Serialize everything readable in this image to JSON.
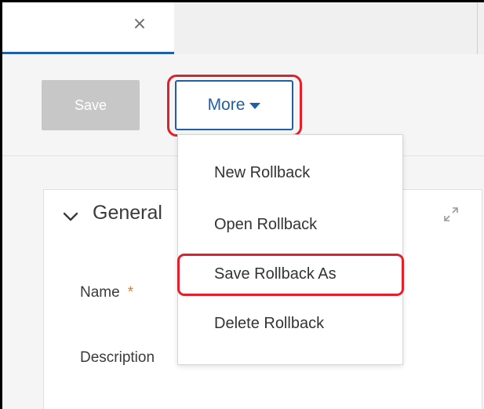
{
  "tab": {
    "close_glyph": "×"
  },
  "toolbar": {
    "save_label": "Save",
    "more_label": "More"
  },
  "menu": {
    "items": [
      {
        "label": "New Rollback"
      },
      {
        "label": "Open Rollback"
      },
      {
        "label": "Save Rollback As"
      },
      {
        "label": "Delete Rollback"
      }
    ],
    "highlighted_index": 2
  },
  "panel": {
    "title": "General",
    "fields": [
      {
        "label": "Name",
        "required_mark": "*"
      },
      {
        "label": "Description",
        "required_mark": ""
      }
    ]
  },
  "icons": {
    "tab_close": "close-icon",
    "more_caret": "caret-down-icon",
    "panel_toggle": "chevron-down-icon",
    "panel_expand": "expand-icon"
  },
  "colors": {
    "accent": "#1f5ea8",
    "highlight": "#e0202a",
    "disabled_button": "#c7c7c7",
    "required": "#e07a2c"
  }
}
